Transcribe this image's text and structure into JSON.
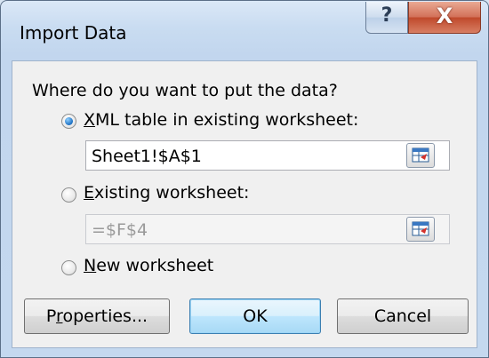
{
  "window": {
    "title": "Import Data",
    "help_label": "?",
    "close_label": "X"
  },
  "prompt": "Where do you want to put the data?",
  "options": {
    "xml_table": {
      "mnemonic": "X",
      "rest": "ML table in existing worksheet:",
      "checked": true,
      "value": "Sheet1!$A$1"
    },
    "existing_worksheet": {
      "mnemonic": "E",
      "rest": "xisting worksheet:",
      "checked": false,
      "value": "=$F$4"
    },
    "new_worksheet": {
      "mnemonic": "N",
      "rest": "ew worksheet",
      "checked": false
    }
  },
  "buttons": {
    "properties": {
      "pre": "P",
      "mnemonic": "r",
      "rest": "operties..."
    },
    "ok": "OK",
    "cancel": "Cancel"
  }
}
